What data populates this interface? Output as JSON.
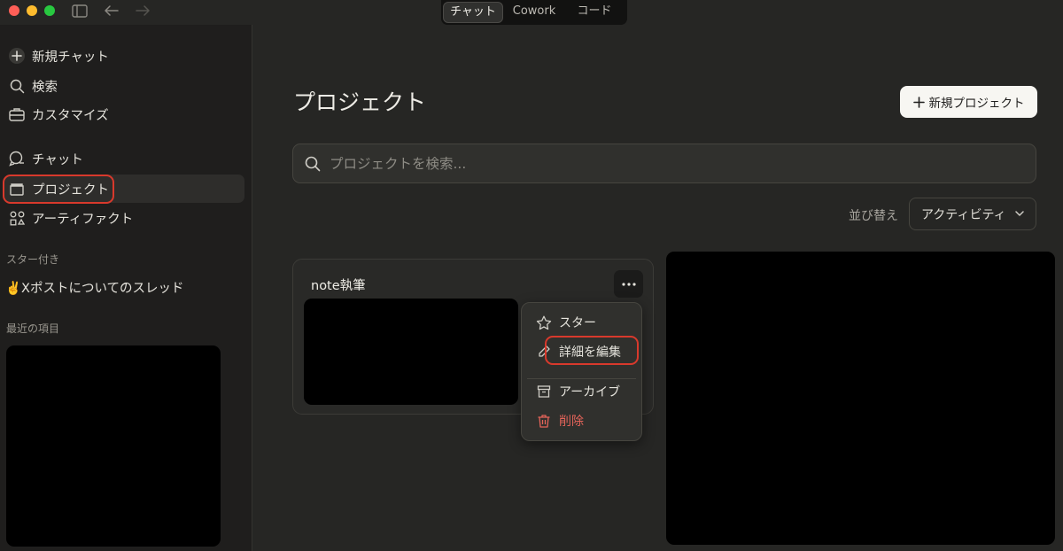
{
  "window": {
    "mode_tabs": [
      "チャット",
      "Cowork",
      "コード"
    ],
    "active_mode": "チャット",
    "icons": [
      "sidebar-toggle-icon",
      "back-arrow-icon",
      "forward-arrow-icon"
    ]
  },
  "sidebar": {
    "new_chat": "新規チャット",
    "search": "検索",
    "customize": "カスタマイズ",
    "chat": "チャット",
    "projects": "プロジェクト",
    "artifacts": "アーティファクト",
    "starred_heading": "スター付き",
    "starred_item": "✌️Xポストについてのスレッド",
    "recent_heading": "最近の項目"
  },
  "main": {
    "title": "プロジェクト",
    "new_project_button": "新規プロジェクト",
    "search_placeholder": "プロジェクトを検索...",
    "sort_label": "並び替え",
    "sort_value": "アクティビティ"
  },
  "project_card": {
    "title": "note執筆"
  },
  "context_menu": {
    "star": "スター",
    "edit_details": "詳細を編集",
    "archive": "アーカイブ",
    "delete": "削除"
  },
  "colors": {
    "background": "#262624",
    "sidebar": "#1f1e1d",
    "highlight_ring": "#d8392c",
    "danger": "#e5645a"
  }
}
